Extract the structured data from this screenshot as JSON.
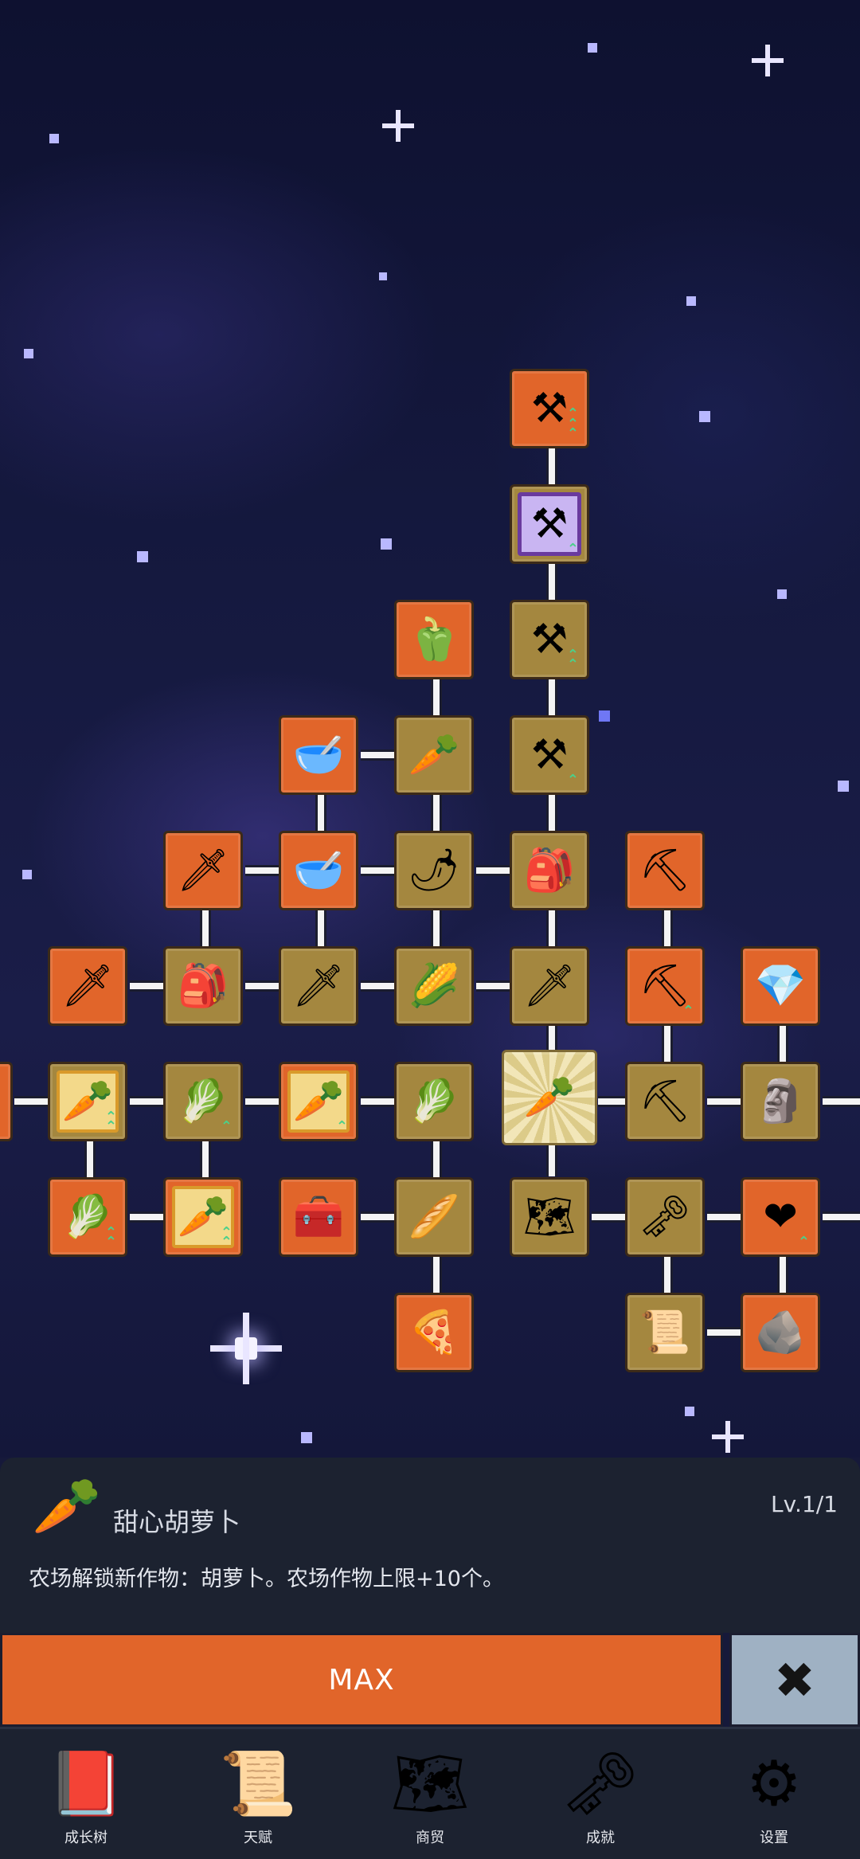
{
  "tree": {
    "icons": {
      "shovel": "⚒",
      "pepper": "🫑",
      "radish": "🥕",
      "bowl": "🥣",
      "chili": "🌶",
      "backpack": "🎒",
      "sword": "🗡",
      "pickaxe": "⛏",
      "corn": "🌽",
      "crystal": "💎",
      "carrot": "🥕",
      "cabbage": "🥬",
      "statue": "🗿",
      "chest": "🧰",
      "parsnip": "🥖",
      "map": "🗺",
      "key": "🗝",
      "heart": "❤",
      "pizza": "🍕",
      "scroll": "📜",
      "stone": "🪨"
    },
    "selected_item": "sweet-carrot"
  },
  "detail": {
    "icon": "🥕",
    "title": "甜心胡萝卜",
    "level": "Lv.1/1",
    "description": "农场解锁新作物：胡萝卜。农场作物上限+10个。"
  },
  "actions": {
    "max_label": "MAX",
    "close_label": "✖"
  },
  "nav": {
    "items": [
      {
        "label": "成长树",
        "icon": "📕"
      },
      {
        "label": "天赋",
        "icon": "📜"
      },
      {
        "label": "商贸",
        "icon": "🗺"
      },
      {
        "label": "成就",
        "icon": "🗝"
      },
      {
        "label": "设置",
        "icon": "⚙"
      }
    ]
  },
  "colors": {
    "orange_node": "#e1652a",
    "gold_node": "#a4873f",
    "panel": "#1c2230",
    "close_button": "#9fb1c3"
  }
}
